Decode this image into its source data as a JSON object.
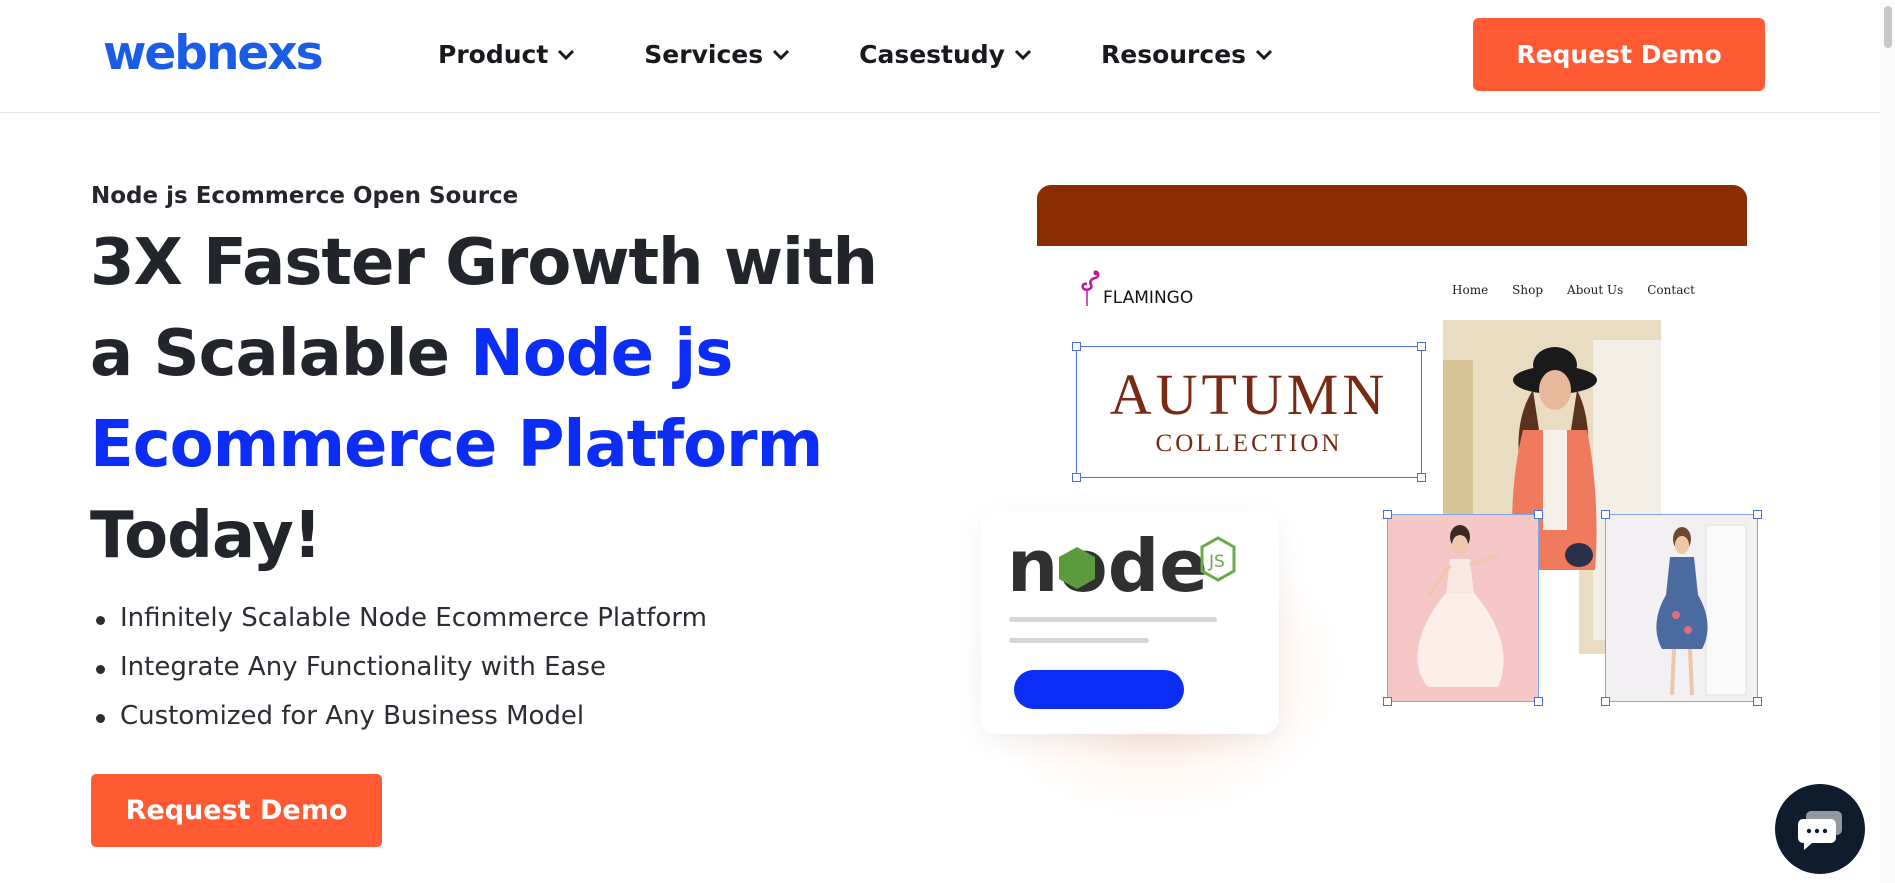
{
  "header": {
    "logo": "webnexs",
    "nav": [
      {
        "label": "Product"
      },
      {
        "label": "Services"
      },
      {
        "label": "Casestudy"
      },
      {
        "label": "Resources"
      }
    ],
    "cta_label": "Request Demo"
  },
  "hero": {
    "eyebrow": "Node js Ecommerce Open Source",
    "headline_part1": "3X Faster Growth with a Scalable ",
    "headline_highlight": "Node js Ecommerce Platform",
    "headline_part2": " Today!",
    "bullets": [
      "Infinitely Scalable Node Ecommerce Platform",
      "Integrate Any Functionality with Ease",
      "Customized for Any Business Model"
    ],
    "cta_label": "Request Demo"
  },
  "illustration": {
    "store_logo": "FLAMINGO",
    "store_nav": [
      "Home",
      "Shop",
      "About Us",
      "Contact"
    ],
    "banner_title": "AUTUMN",
    "banner_subtitle": "COLLECTION",
    "node_logo": "node"
  },
  "colors": {
    "brand_blue": "#1a5ce6",
    "accent_blue": "#0b2df5",
    "cta_orange": "#ff5a33",
    "topbar_brown": "#8a2e02"
  }
}
